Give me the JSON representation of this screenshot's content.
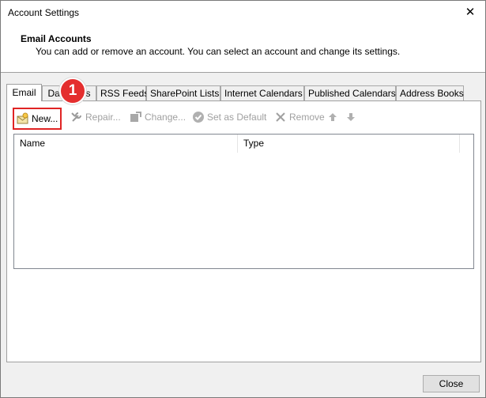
{
  "window": {
    "title": "Account Settings",
    "close_glyph": "✕"
  },
  "header": {
    "title": "Email Accounts",
    "subtitle": "You can add or remove an account. You can select an account and change its settings."
  },
  "tabs": [
    {
      "label": "Email",
      "active": true
    },
    {
      "label": "Data Files",
      "active": false
    },
    {
      "label": "RSS Feeds",
      "active": false
    },
    {
      "label": "SharePoint Lists",
      "active": false
    },
    {
      "label": "Internet Calendars",
      "active": false
    },
    {
      "label": "Published Calendars",
      "active": false
    },
    {
      "label": "Address Books",
      "active": false
    }
  ],
  "toolbar": {
    "new_label": "New...",
    "repair_label": "Repair...",
    "change_label": "Change...",
    "set_default_label": "Set as Default",
    "remove_label": "Remove",
    "move_up_icon": "arrow-up-icon",
    "move_down_icon": "arrow-down-icon"
  },
  "list": {
    "columns": [
      "Name",
      "Type"
    ],
    "rows": []
  },
  "callout": {
    "number": "1",
    "color": "#e42e2e"
  },
  "footer": {
    "close_label": "Close"
  }
}
